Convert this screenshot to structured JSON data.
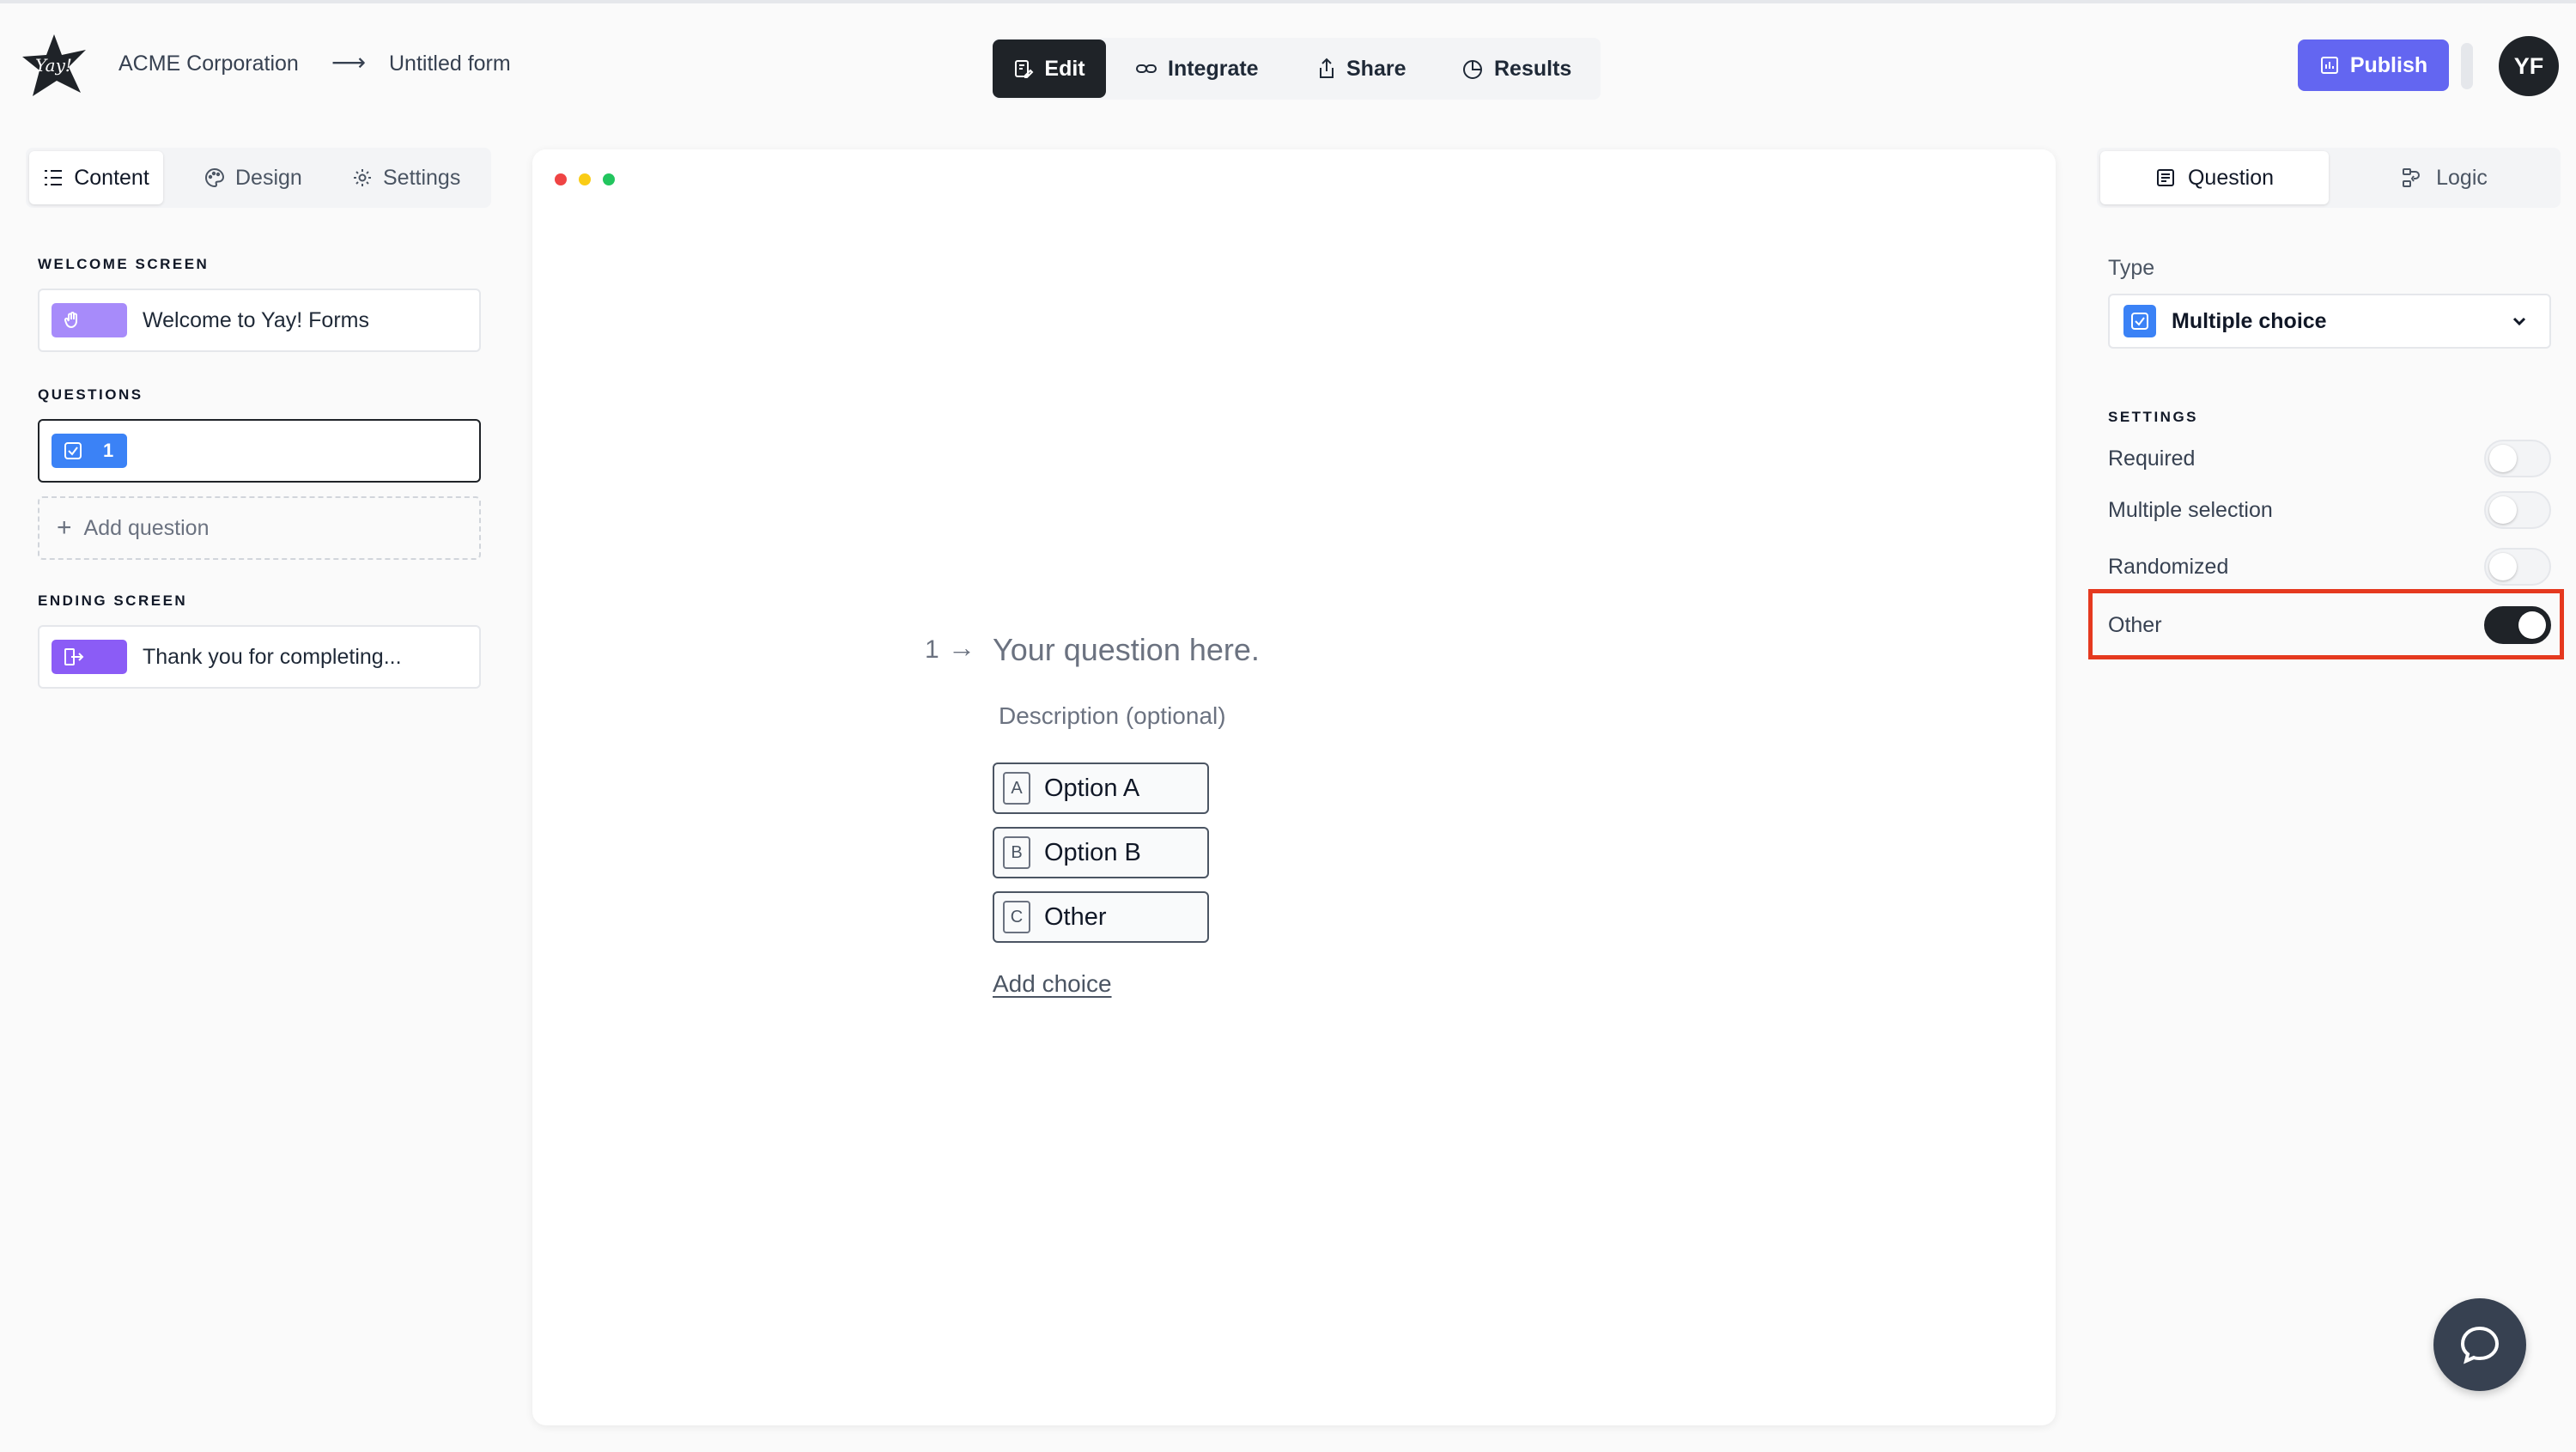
{
  "header": {
    "company": "ACME Corporation",
    "arrow": "⟶",
    "form_name": "Untitled form",
    "nav": {
      "edit": "Edit",
      "integrate": "Integrate",
      "share": "Share",
      "results": "Results"
    },
    "publish": "Publish",
    "avatar_initials": "YF"
  },
  "left_panel": {
    "tabs": {
      "content": "Content",
      "design": "Design",
      "settings": "Settings"
    },
    "welcome_label": "WELCOME SCREEN",
    "welcome_item": "Welcome to Yay! Forms",
    "questions_label": "QUESTIONS",
    "question_number": "1",
    "add_question": "Add question",
    "ending_label": "ENDING SCREEN",
    "ending_item": "Thank you for completing..."
  },
  "canvas": {
    "question_number": "1",
    "arrow": "→",
    "question_text": "Your question here.",
    "description": "Description (optional)",
    "options": [
      {
        "key": "A",
        "label": "Option A"
      },
      {
        "key": "B",
        "label": "Option B"
      },
      {
        "key": "C",
        "label": "Other"
      }
    ],
    "add_choice": "Add choice"
  },
  "right_panel": {
    "tabs": {
      "question": "Question",
      "logic": "Logic"
    },
    "type_label": "Type",
    "type_value": "Multiple choice",
    "settings_label": "SETTINGS",
    "settings": [
      {
        "label": "Required",
        "on": false
      },
      {
        "label": "Multiple selection",
        "on": false
      },
      {
        "label": "Randomized",
        "on": false
      },
      {
        "label": "Other",
        "on": true
      }
    ]
  },
  "colors": {
    "accent": "#6366f1",
    "dark": "#1f2328",
    "question_chip": "#3b82f6",
    "highlight": "#e5391f"
  },
  "icons": {
    "logo": "yay-star-logo",
    "help": "chat-bubble-icon"
  }
}
